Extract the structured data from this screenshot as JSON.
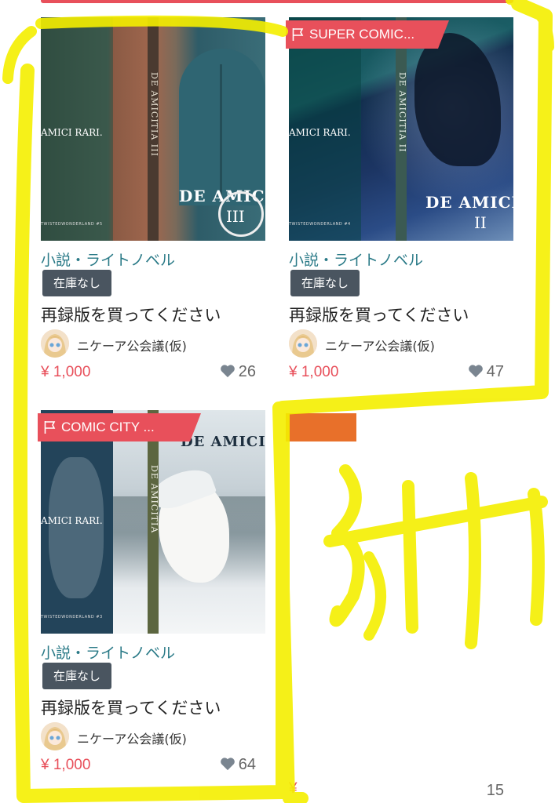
{
  "colors": {
    "accent": "#e8505b",
    "category": "#2a7a87",
    "stock_badge": "#4a5560",
    "highlighter": "#f5ef00"
  },
  "products": [
    {
      "event_tag": "",
      "cover": {
        "amici": "AMICI RARI.",
        "spine": "DE AMICITIA III",
        "title": "DE AMICI",
        "volume": "III",
        "series": "TWISTEDWONDERLAND #5"
      },
      "category": "小説・ライトノベル",
      "stock": "在庫なし",
      "name": "再録版を買ってください",
      "seller": "ニケーア公会議(仮)",
      "price": "¥ 1,000",
      "likes": "26"
    },
    {
      "event_tag": "SUPER COMIC...",
      "cover": {
        "amici": "AMICI RARI.",
        "spine": "DE AMICITIA II",
        "title": "DE AMICI",
        "volume": "II",
        "series": "TWISTEDWONDERLAND #4"
      },
      "category": "小説・ライトノベル",
      "stock": "在庫なし",
      "name": "再録版を買ってください",
      "seller": "ニケーア公会議(仮)",
      "price": "¥ 1,000",
      "likes": "47"
    },
    {
      "event_tag": "COMIC CITY ...",
      "cover": {
        "amici": "AMICI RARI.",
        "spine": "DE AMICITIA",
        "title": "DE AMICI",
        "volume": "",
        "series": "TWISTEDWONDERLAND #3"
      },
      "category": "小説・ライトノベル",
      "stock": "在庫なし",
      "name": "再録版を買ってください",
      "seller": "ニケーア公会議(仮)",
      "price": "¥ 1,000",
      "likes": "64"
    },
    {
      "event_tag": "",
      "price": "¥",
      "likes": "15"
    }
  ],
  "annotation": {
    "text": "3冊",
    "icon": "yellow-highlighter-scribble"
  }
}
